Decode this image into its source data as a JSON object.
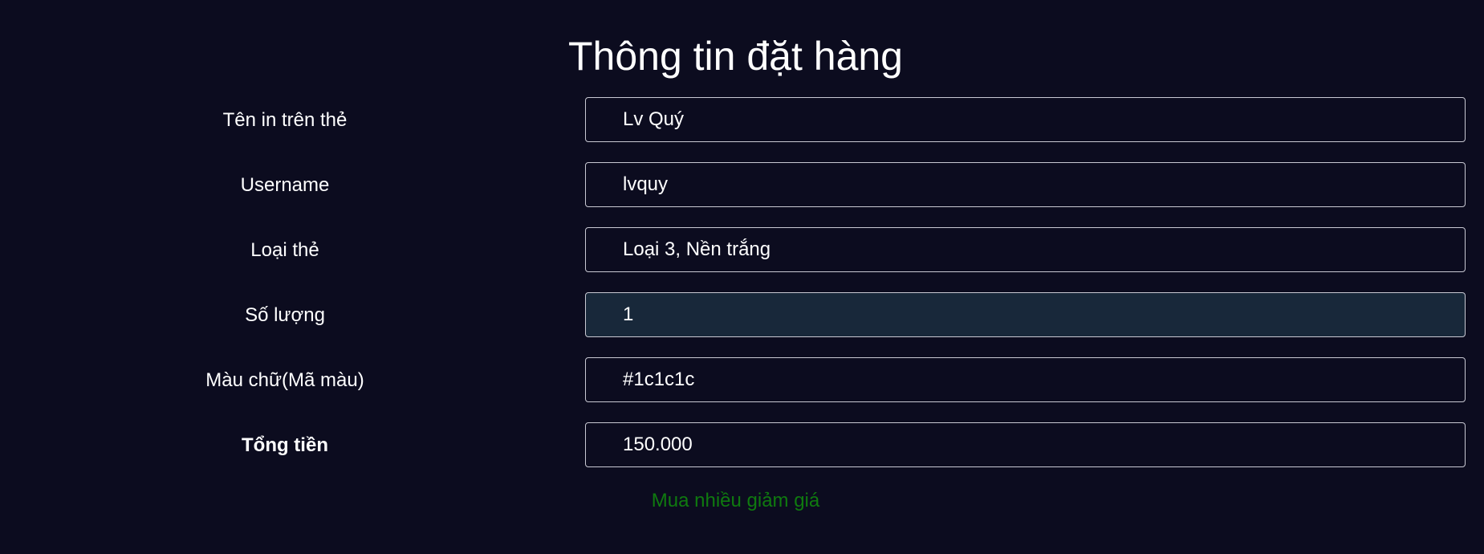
{
  "title": "Thông tin đặt hàng",
  "fields": [
    {
      "label": "Tên in trên thẻ",
      "value": "Lv Quý"
    },
    {
      "label": "Username",
      "value": "lvquy"
    },
    {
      "label": "Loại thẻ",
      "value": "Loại 3, Nền trắng"
    },
    {
      "label": "Số lượng",
      "value": "1"
    },
    {
      "label": "Màu chữ(Mã màu)",
      "value": "#1c1c1c"
    },
    {
      "label": "Tổng tiền",
      "value": "150.000"
    }
  ],
  "promo_note": "Mua nhiều giảm giá",
  "colors": {
    "background": "#0c0c1f",
    "input_border": "#c9c9d3",
    "focused_input_background": "#18283a",
    "promo_text": "#0f7a0f"
  }
}
